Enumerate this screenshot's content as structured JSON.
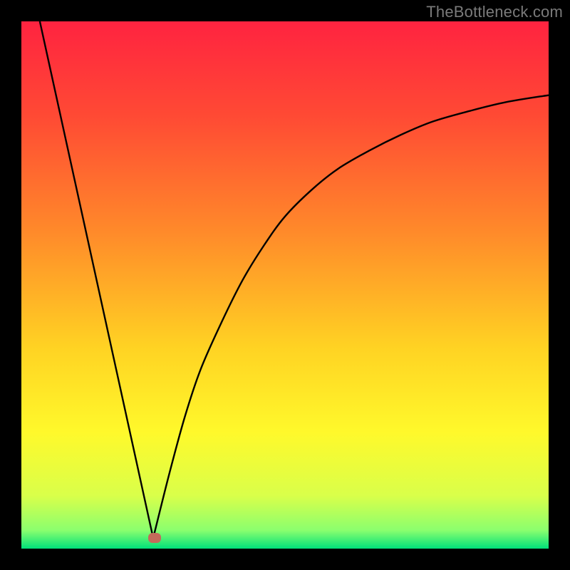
{
  "attribution": "TheBottleneck.com",
  "chart_data": {
    "type": "line",
    "title": "",
    "xlabel": "",
    "ylabel": "",
    "xlim": [
      0,
      100
    ],
    "ylim": [
      0,
      100
    ],
    "grid": false,
    "gradient_stops": [
      {
        "offset": 0.0,
        "color": "#ff2340"
      },
      {
        "offset": 0.18,
        "color": "#ff4a34"
      },
      {
        "offset": 0.4,
        "color": "#ff8a2a"
      },
      {
        "offset": 0.62,
        "color": "#ffd323"
      },
      {
        "offset": 0.78,
        "color": "#fff92b"
      },
      {
        "offset": 0.9,
        "color": "#d9ff4a"
      },
      {
        "offset": 0.965,
        "color": "#8bff6e"
      },
      {
        "offset": 1.0,
        "color": "#00e07a"
      }
    ],
    "series": [
      {
        "name": "left-branch",
        "x": [
          3.5,
          25.0
        ],
        "y": [
          100,
          2
        ]
      },
      {
        "name": "right-branch",
        "x": [
          25.0,
          28,
          31,
          34,
          38,
          42,
          46,
          50,
          55,
          60,
          66,
          72,
          78,
          85,
          92,
          100
        ],
        "y": [
          2,
          14,
          25,
          34,
          43,
          51,
          57.5,
          63,
          68,
          72,
          75.5,
          78.5,
          81,
          83,
          84.7,
          86
        ]
      }
    ],
    "marker": {
      "x": 25.3,
      "y": 2,
      "color": "#c46a5a"
    }
  }
}
